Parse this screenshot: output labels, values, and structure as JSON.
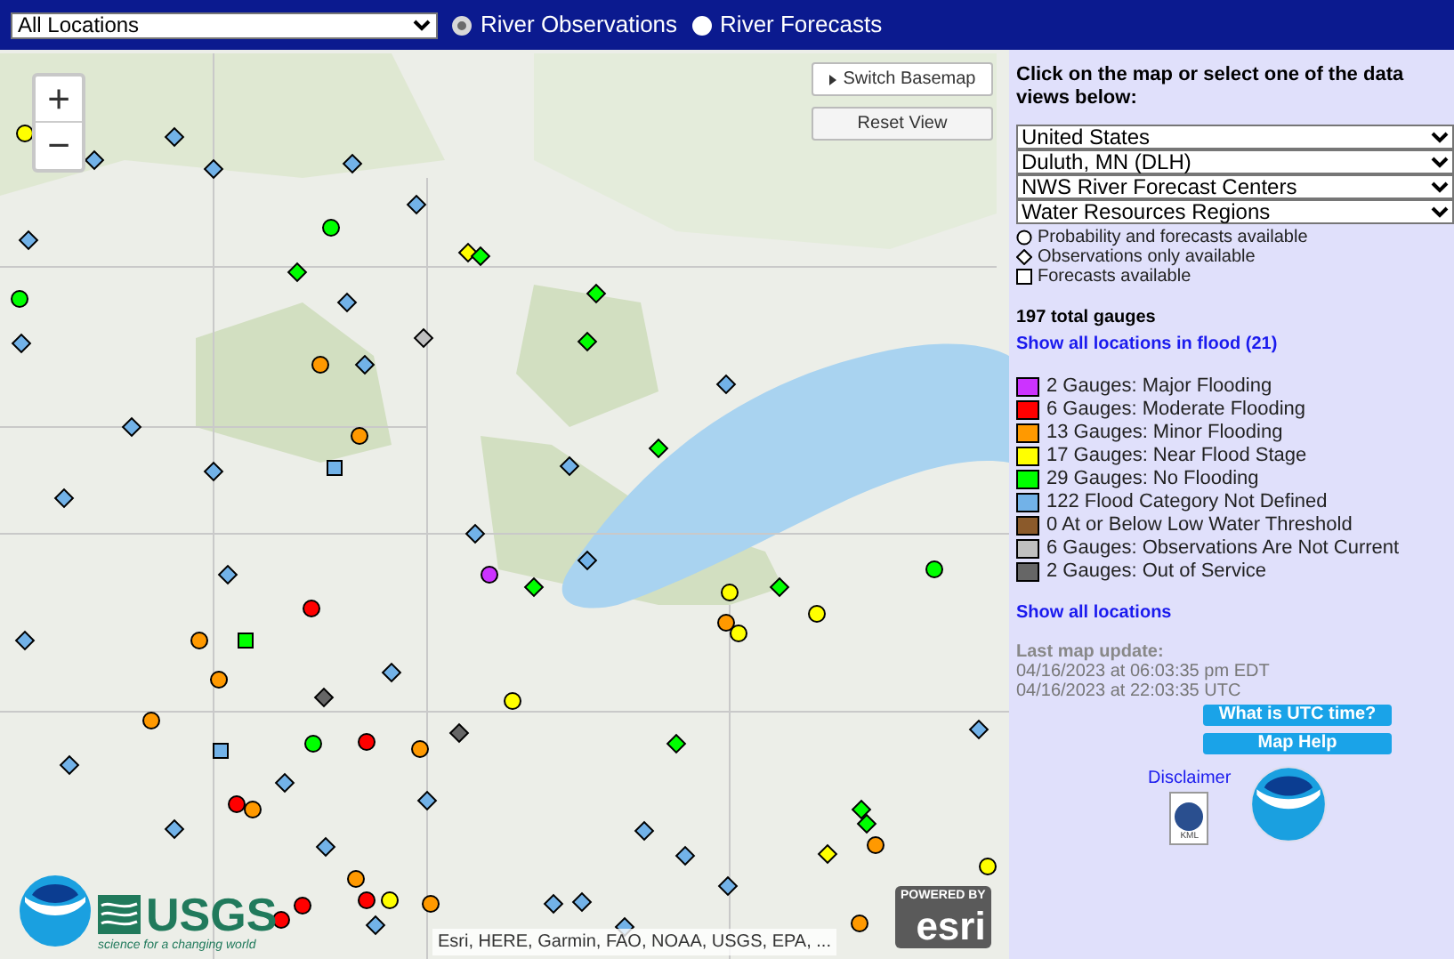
{
  "location_select": {
    "value": "All Locations"
  },
  "view_options": [
    {
      "label": "River Observations",
      "selected": true
    },
    {
      "label": "River Forecasts",
      "selected": false
    }
  ],
  "map": {
    "zoom_in": "+",
    "zoom_out": "−",
    "switch_basemap": "Switch Basemap",
    "reset_view": "Reset View",
    "attribution": "Esri, HERE, Garmin, FAO, NOAA, USGS, EPA, ...",
    "usgs": "USGS",
    "usgs_tagline": "science for a changing world",
    "esri_powered": "POWERED BY",
    "esri": "esri"
  },
  "panel": {
    "intro": "Click on the map or select one of the data views below:",
    "selects": [
      "United States",
      "Duluth, MN (DLH)",
      "NWS River Forecast Centers",
      "Water Resources Regions"
    ],
    "symbols": [
      {
        "kind": "circle",
        "label": "Probability and forecasts available"
      },
      {
        "kind": "diamond",
        "label": "Observations only available"
      },
      {
        "kind": "square",
        "label": "Forecasts available"
      }
    ],
    "total": "197 total gauges",
    "flood_link": "Show all locations in flood (21)",
    "legend": [
      {
        "label": "2 Gauges: Major Flooding",
        "color": "#cc33ff"
      },
      {
        "label": "6 Gauges: Moderate Flooding",
        "color": "#ff0000"
      },
      {
        "label": "13 Gauges: Minor Flooding",
        "color": "#ff9900"
      },
      {
        "label": "17 Gauges: Near Flood Stage",
        "color": "#ffff00"
      },
      {
        "label": "29 Gauges: No Flooding",
        "color": "#00ff00"
      },
      {
        "label": "122 Flood Category Not Defined",
        "color": "#72b2e8"
      },
      {
        "label": "0 At or Below Low Water Threshold",
        "color": "#8b5a2b"
      },
      {
        "label": "6 Gauges: Observations Are Not Current",
        "color": "#c0c0c0"
      },
      {
        "label": "2 Gauges: Out of Service",
        "color": "#666666"
      }
    ],
    "all_link": "Show all locations",
    "update_heading": "Last map update:",
    "update_lines": [
      "04/16/2023 at 06:03:35 pm EDT",
      "04/16/2023 at 22:03:35 UTC"
    ],
    "buttons": [
      "What is UTC time?",
      "Map Help"
    ],
    "disclaimer": "Disclaimer",
    "kml": "KML"
  }
}
